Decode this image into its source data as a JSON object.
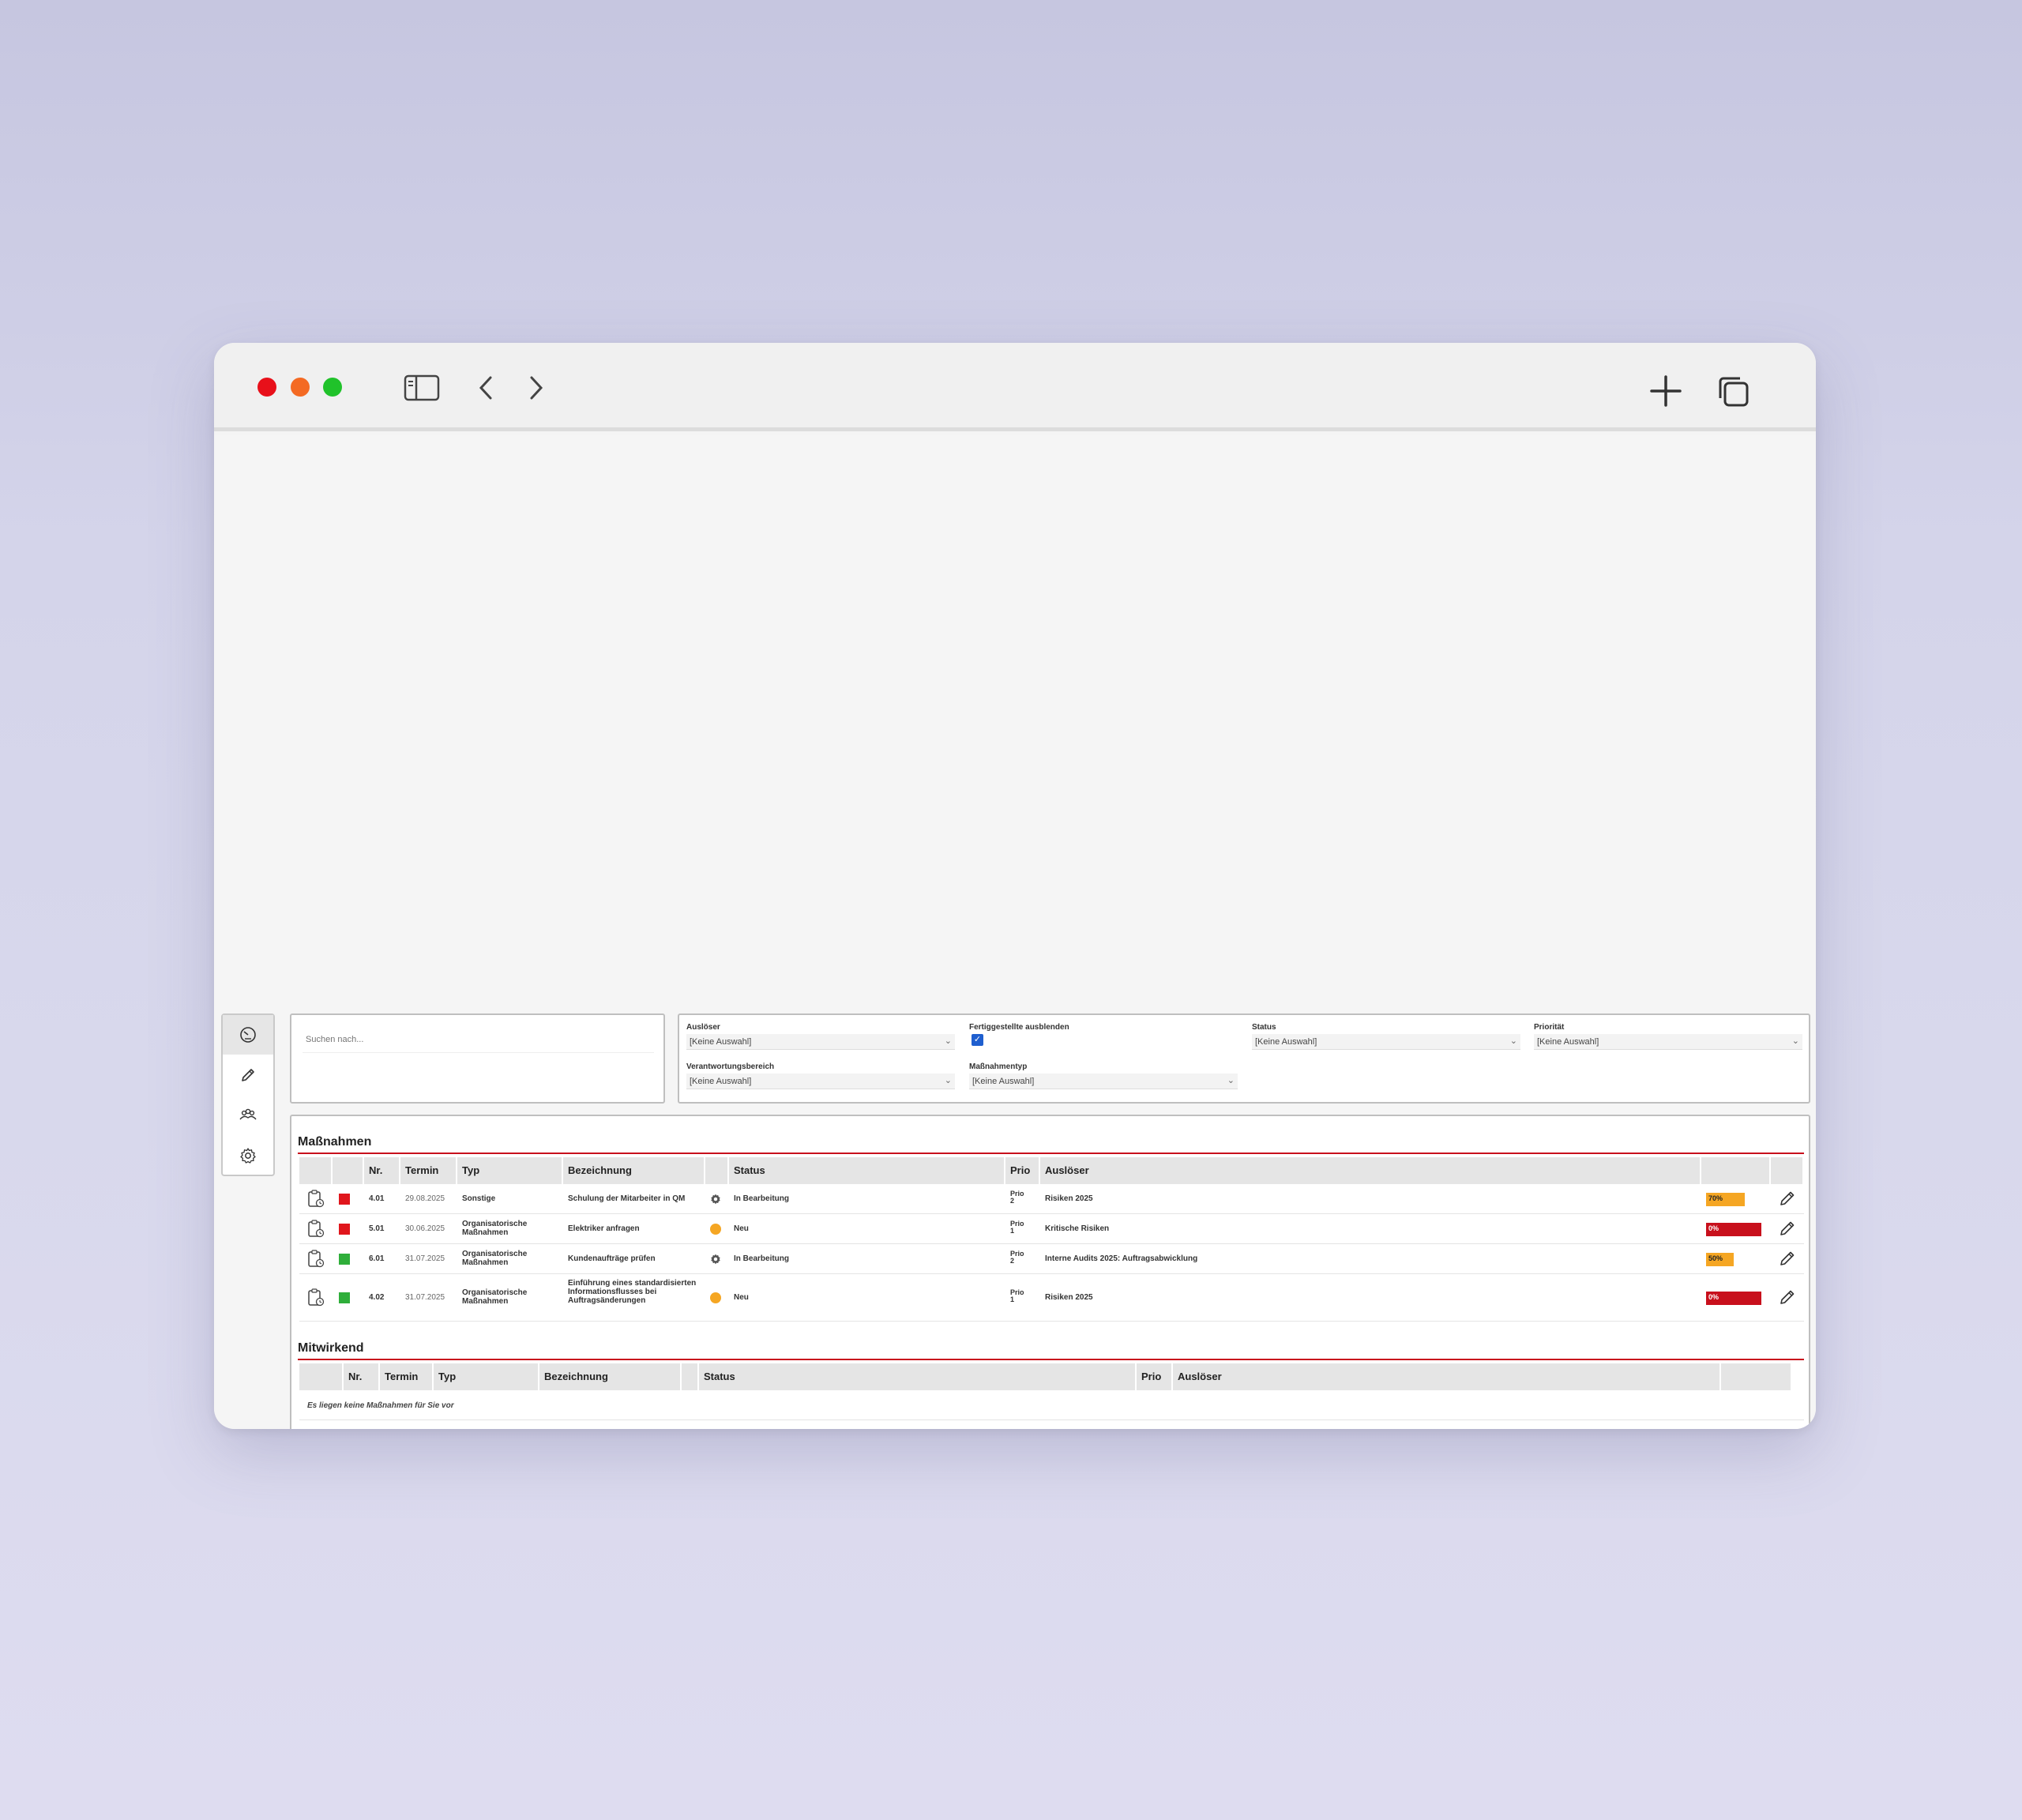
{
  "search": {
    "placeholder": "Suchen nach..."
  },
  "filters": {
    "ausloeser": {
      "label": "Auslöser",
      "value": "[Keine Auswahl]"
    },
    "fertiggestellte": {
      "label": "Fertiggestellte ausblenden",
      "checked": true
    },
    "status": {
      "label": "Status",
      "value": "[Keine Auswahl]"
    },
    "prioritaet": {
      "label": "Priorität",
      "value": "[Keine Auswahl]"
    },
    "verantwortungsbereich": {
      "label": "Verantwortungsbereich",
      "value": "[Keine Auswahl]"
    },
    "massnahmentyp": {
      "label": "Maßnahmentyp",
      "value": "[Keine Auswahl]"
    }
  },
  "massnahmen": {
    "title": "Maßnahmen",
    "columns": [
      "Nr.",
      "Termin",
      "Typ",
      "Bezeichnung",
      "Status",
      "Prio",
      "Auslöser"
    ],
    "rows": [
      {
        "marker": "red",
        "nr": "4.01",
        "termin": "29.08.2025",
        "typ": "Sonstige",
        "bezeichnung": "Schulung der Mitarbeiter in QM",
        "status_icon": "gear-icon",
        "status": "In Bearbeitung",
        "prio": "Prio 2",
        "ausloeser": "Risiken 2025",
        "progress": 70,
        "progress_label": "70%",
        "progress_color": "#f5a623"
      },
      {
        "marker": "red",
        "nr": "5.01",
        "termin": "30.06.2025",
        "typ": "Organisatorische Maßnahmen",
        "bezeichnung": "Elektriker anfragen",
        "status_icon": "circle-icon",
        "status": "Neu",
        "prio": "Prio 1",
        "ausloeser": "Kritische Risiken",
        "progress": 0,
        "progress_label": "0%",
        "progress_color": "#c8101c"
      },
      {
        "marker": "green",
        "nr": "6.01",
        "termin": "31.07.2025",
        "typ": "Organisatorische Maßnahmen",
        "bezeichnung": "Kundenaufträge prüfen",
        "status_icon": "gear-icon",
        "status": "In Bearbeitung",
        "prio": "Prio 2",
        "ausloeser": "Interne Audits 2025: Auftragsabwicklung",
        "progress": 50,
        "progress_label": "50%",
        "progress_color": "#f5a623"
      },
      {
        "marker": "green",
        "nr": "4.02",
        "termin": "31.07.2025",
        "typ": "Organisatorische Maßnahmen",
        "bezeichnung": "Einführung eines standardisierten Informationsflusses bei Auftragsänderungen",
        "status_icon": "circle-icon",
        "status": "Neu",
        "prio": "Prio 1",
        "ausloeser": "Risiken 2025",
        "progress": 0,
        "progress_label": "0%",
        "progress_color": "#c8101c"
      }
    ]
  },
  "mitwirkend": {
    "title": "Mitwirkend",
    "columns": [
      "Nr.",
      "Termin",
      "Typ",
      "Bezeichnung",
      "Status",
      "Prio",
      "Auslöser"
    ],
    "empty_message": "Es liegen keine Maßnahmen für Sie vor"
  },
  "colors": {
    "accent": "#c8101c",
    "panel_border": "#bfbfbf"
  }
}
